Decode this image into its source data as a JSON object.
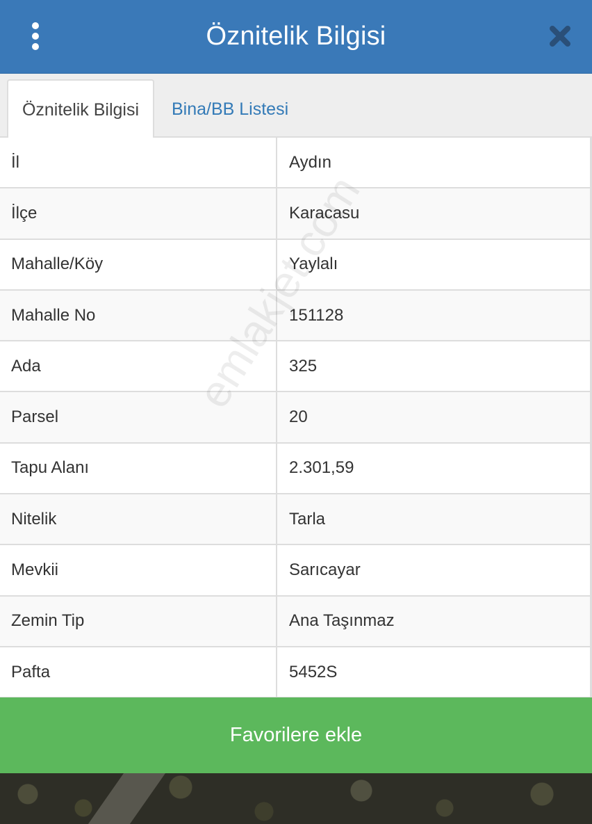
{
  "header": {
    "title": "Öznitelik Bilgisi",
    "menu_icon": "more-vertical-icon",
    "close_icon": "close-icon"
  },
  "tabs": [
    {
      "label": "Öznitelik Bilgisi",
      "active": true
    },
    {
      "label": "Bina/BB Listesi",
      "active": false
    }
  ],
  "rows": [
    {
      "label": "İl",
      "value": "Aydın"
    },
    {
      "label": "İlçe",
      "value": "Karacasu"
    },
    {
      "label": "Mahalle/Köy",
      "value": "Yaylalı"
    },
    {
      "label": "Mahalle No",
      "value": "151128"
    },
    {
      "label": "Ada",
      "value": "325"
    },
    {
      "label": "Parsel",
      "value": "20"
    },
    {
      "label": "Tapu Alanı",
      "value": "2.301,59"
    },
    {
      "label": "Nitelik",
      "value": "Tarla"
    },
    {
      "label": "Mevkii",
      "value": "Sarıcayar"
    },
    {
      "label": "Zemin Tip",
      "value": "Ana Taşınmaz"
    },
    {
      "label": "Pafta",
      "value": "5452S"
    }
  ],
  "favorite_button": {
    "label": "Favorilere ekle"
  },
  "watermark": "emlakjet.com",
  "colors": {
    "header": "#3a79b8",
    "tab_link": "#337ab7",
    "favorite": "#5cb85c"
  }
}
